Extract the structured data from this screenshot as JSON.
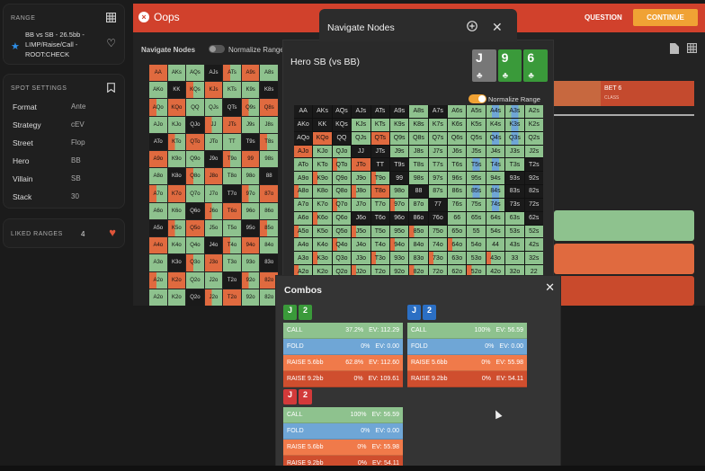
{
  "range_card": {
    "label": "RANGE",
    "title": "BB vs SB - 26.5bb - LIMP/Raise/Call - ROOT:CHECK"
  },
  "spot_settings": {
    "label": "SPOT SETTINGS",
    "rows": [
      {
        "k": "Format",
        "v": "Ante"
      },
      {
        "k": "Strategy",
        "v": "cEV"
      },
      {
        "k": "Street",
        "v": "Flop"
      },
      {
        "k": "Hero",
        "v": "BB"
      },
      {
        "k": "Villain",
        "v": "SB"
      },
      {
        "k": "Stack",
        "v": "30"
      }
    ]
  },
  "liked": {
    "label": "LIKED RANGES",
    "count": "4"
  },
  "topbar": {
    "title": "Oops",
    "question": "QUESTION",
    "continue": "CONTINUE",
    "bet_label": "BET 6",
    "bet_sub": "CLASS"
  },
  "bg_panel": {
    "navigate": "Navigate Nodes",
    "normalize": "Normalize Range"
  },
  "modal": {
    "title": "Navigate Nodes",
    "hero": "Hero SB (vs BB)",
    "normalize": "Normalize Range",
    "board": [
      {
        "rank": "J",
        "color": "#777777"
      },
      {
        "rank": "9",
        "color": "#3a9a3a"
      },
      {
        "rank": "6",
        "color": "#3a9a3a"
      }
    ]
  },
  "matrix": {
    "ranks": [
      "A",
      "K",
      "Q",
      "J",
      "T",
      "9",
      "8",
      "7",
      "6",
      "5",
      "4",
      "3",
      "2"
    ],
    "colors": {
      "call": "#8ec28e",
      "fold": "#6fa6d6",
      "raise": "#e06a3f",
      "raise_big": "#c94a2c",
      "dark": "#1a1a1a"
    }
  },
  "combos": {
    "title": "Combos",
    "groups": [
      {
        "cards": [
          {
            "r": "J",
            "c": "#3a9a3a"
          },
          {
            "r": "2",
            "c": "#3a9a3a"
          }
        ],
        "rows": [
          {
            "a": "CALL",
            "p": "37.2%",
            "ev": "EV: 112.29",
            "c": "#8ec28e"
          },
          {
            "a": "FOLD",
            "p": "0%",
            "ev": "EV: 0.00",
            "c": "#6fa6d6"
          },
          {
            "a": "RAISE 5.6bb",
            "p": "62.8%",
            "ev": "EV: 112.60",
            "c": "#f07a4a"
          },
          {
            "a": "RAISE 9.2bb",
            "p": "0%",
            "ev": "EV: 109.61",
            "c": "#cf4e2e"
          }
        ]
      },
      {
        "cards": [
          {
            "r": "J",
            "c": "#2b6fc4"
          },
          {
            "r": "2",
            "c": "#2b6fc4"
          }
        ],
        "rows": [
          {
            "a": "CALL",
            "p": "100%",
            "ev": "EV: 56.59",
            "c": "#8ec28e"
          },
          {
            "a": "FOLD",
            "p": "0%",
            "ev": "EV: 0.00",
            "c": "#6fa6d6"
          },
          {
            "a": "RAISE 5.6bb",
            "p": "0%",
            "ev": "EV: 55.98",
            "c": "#f07a4a"
          },
          {
            "a": "RAISE 9.2bb",
            "p": "0%",
            "ev": "EV: 54.11",
            "c": "#cf4e2e"
          }
        ]
      },
      {
        "cards": [
          {
            "r": "J",
            "c": "#d23a3a"
          },
          {
            "r": "2",
            "c": "#d23a3a"
          }
        ],
        "rows": [
          {
            "a": "CALL",
            "p": "100%",
            "ev": "EV: 56.59",
            "c": "#8ec28e"
          },
          {
            "a": "FOLD",
            "p": "0%",
            "ev": "EV: 0.00",
            "c": "#6fa6d6"
          },
          {
            "a": "RAISE 5.6bb",
            "p": "0%",
            "ev": "EV: 55.98",
            "c": "#f07a4a"
          },
          {
            "a": "RAISE 9.2bb",
            "p": "0%",
            "ev": "EV: 54.11",
            "c": "#cf4e2e"
          }
        ]
      }
    ]
  }
}
